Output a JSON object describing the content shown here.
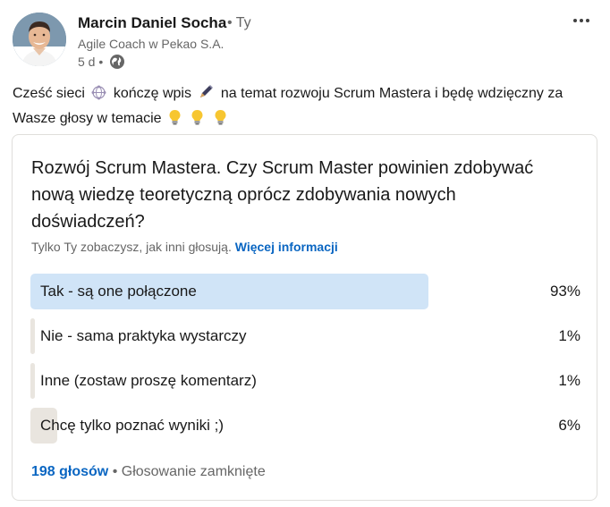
{
  "author": {
    "name": "Marcin Daniel Socha",
    "degree": "• Ty",
    "headline": "Agile Coach w Pekao S.A.",
    "time": "5 d •",
    "visibility_icon": "globe-icon",
    "avatar_icon": "profile-photo"
  },
  "post": {
    "text_part1": "Cześć sieci",
    "text_part2": "kończę wpis",
    "text_part3": "na temat rozwoju Scrum Mastera i będę wdzięczny za Wasze głosy w temacie",
    "emojis": [
      "network-icon",
      "pen-icon",
      "light-bulb-icon",
      "light-bulb-icon",
      "light-bulb-icon"
    ]
  },
  "poll": {
    "question": "Rozwój Scrum Mastera. Czy Scrum Master powinien zdobywać nową wiedzę teoretyczną oprócz zdobywania nowych doświadczeń?",
    "visibility_text": "Tylko Ty zobaczysz, jak inni głosują.",
    "more_info_label": "Więcej informacji",
    "options": [
      {
        "label": "Tak - są one połączone",
        "percent": "93%",
        "fraction": 0.93,
        "selected": true
      },
      {
        "label": "Nie - sama praktyka wystarczy",
        "percent": "1%",
        "fraction": 0.01,
        "selected": false
      },
      {
        "label": "Inne (zostaw proszę komentarz)",
        "percent": "1%",
        "fraction": 0.01,
        "selected": false
      },
      {
        "label": "Chcę tylko poznać wyniki ;)",
        "percent": "6%",
        "fraction": 0.06,
        "selected": false
      }
    ],
    "votes_label": "198 głosów",
    "status": "• Głosowanie zamknięte"
  },
  "colors": {
    "link": "#0a66c2",
    "selected_bar": "#d0e4f7",
    "bar": "#e9e5df",
    "muted_text": "#666666"
  }
}
